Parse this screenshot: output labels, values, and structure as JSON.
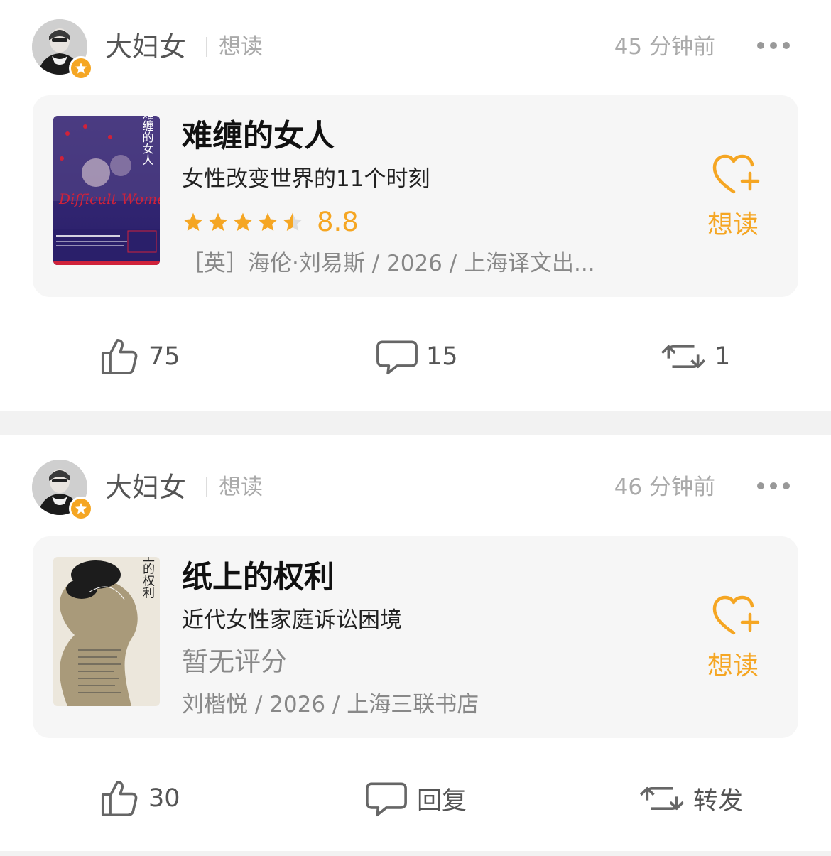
{
  "posts": [
    {
      "user": {
        "name": "大妇女",
        "action": "想读"
      },
      "time": "45 分钟前",
      "book": {
        "title": "难缠的女人",
        "subtitle": "女性改变世界的11个时刻",
        "rating": "8.8",
        "rating_stars": 4.5,
        "meta": "［英］海伦·刘易斯 / 2026 / 上海译文出...",
        "cover_title": "难缠的女人",
        "cover_english": "Difficult Women"
      },
      "want_read_label": "想读",
      "likes": "75",
      "comments": "15",
      "reposts": "1"
    },
    {
      "user": {
        "name": "大妇女",
        "action": "想读"
      },
      "time": "46 分钟前",
      "book": {
        "title": "纸上的权利",
        "subtitle": "近代女性家庭诉讼困境",
        "rating_text": "暂无评分",
        "meta": "刘楷悦 / 2026 / 上海三联书店",
        "cover_title": "纸上的权利"
      },
      "want_read_label": "想读",
      "likes": "30",
      "comments": "回复",
      "reposts": "转发"
    }
  ],
  "colors": {
    "accent": "#f5a623",
    "card_bg": "#f6f6f6",
    "muted": "#aaaaaa"
  }
}
